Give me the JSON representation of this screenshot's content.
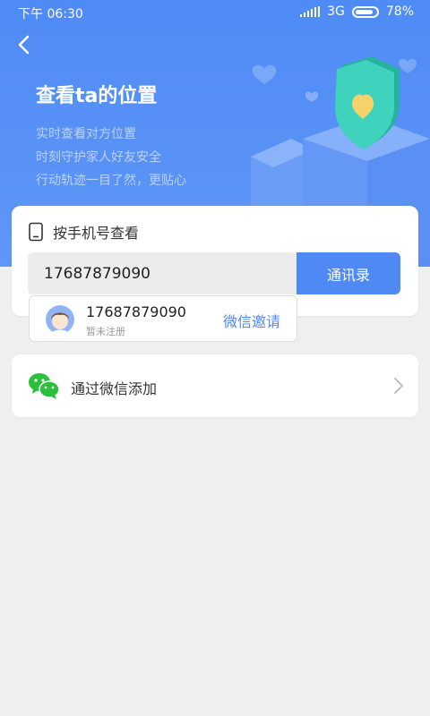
{
  "status": {
    "time": "下午 06:30",
    "network": "3G",
    "battery": "78%"
  },
  "hero": {
    "title": "查看ta的位置",
    "lines": [
      "实时查看对方位置",
      "时刻守护家人好友安全",
      "行动轨迹一目了然，更贴心"
    ]
  },
  "phone_lookup": {
    "heading": "按手机号查看",
    "input_value": "17687879090",
    "contacts_button": "通讯录"
  },
  "suggestion": {
    "number": "17687879090",
    "status": "暂未注册",
    "invite": "微信邀请"
  },
  "wechat_add": {
    "label": "通过微信添加"
  },
  "colors": {
    "accent": "#4f89f4",
    "hero_bg": "#4f8bf5",
    "wechat_green": "#2bc03c"
  },
  "icons": [
    "back-arrow-icon",
    "signal-icon",
    "battery-icon",
    "phone-icon",
    "wechat-icon",
    "chevron-right-icon",
    "shield-illustration",
    "heart-icon"
  ]
}
